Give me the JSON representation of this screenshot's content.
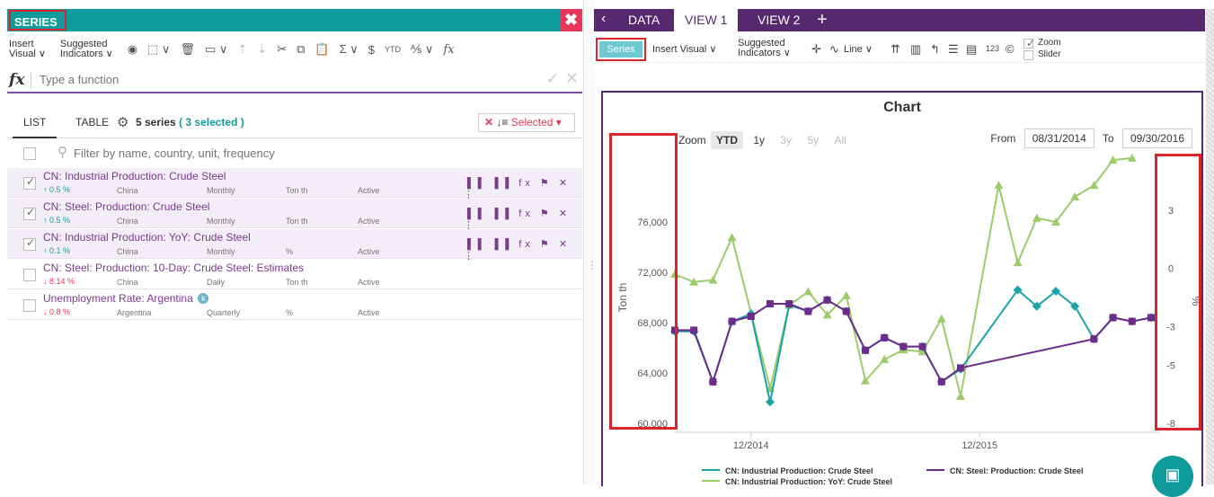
{
  "left": {
    "title": "SERIES",
    "close_icon": "close-x-icon",
    "toolbar": {
      "insert_visual_l1": "Insert",
      "insert_visual_l2": "Visual ∨",
      "suggested_l1": "Suggested",
      "suggested_l2": "Indicators ∨",
      "icons": [
        "eye-icon",
        "select-icon",
        "trash-icon",
        "folder-icon",
        "up-arrow-icon",
        "down-arrow-icon",
        "cut-icon",
        "copy-icon",
        "paste-icon",
        "sigma-icon",
        "dollar-icon",
        "ytd-icon",
        "color-icon",
        "fx-icon"
      ]
    },
    "function_bar": {
      "fx_label": "fx",
      "placeholder": "Type a function",
      "ok_glyph": "✓",
      "cancel_glyph": "✕"
    },
    "tabs": {
      "list": "LIST",
      "table": "TABLE",
      "count_text": "5 series",
      "selected_text": "( 3 selected )",
      "selected_dropdown": "Selected ▾",
      "clear_glyph": "✕",
      "sort_glyph": "↓≡"
    },
    "filter_placeholder": "Filter by name, country, unit, frequency",
    "rows": [
      {
        "name": "CN: Industrial Production: Crude Steel",
        "change": "↑ 0.5 %",
        "dir": "up",
        "country": "China",
        "freq": "Monthly",
        "unit": "Ton th",
        "status": "Active",
        "selected": true,
        "checked": true
      },
      {
        "name": "CN: Steel: Production: Crude Steel",
        "change": "↑ 0.5 %",
        "dir": "up",
        "country": "China",
        "freq": "Monthly",
        "unit": "Ton th",
        "status": "Active",
        "selected": true,
        "checked": true
      },
      {
        "name": "CN: Industrial Production: YoY: Crude Steel",
        "change": "↑ 0.1 %",
        "dir": "up",
        "country": "China",
        "freq": "Monthly",
        "unit": "%",
        "status": "Active",
        "selected": true,
        "checked": true
      },
      {
        "name": "CN: Steel: Production: 10-Day: Crude Steel: Estimates",
        "change": "↓ 8.14 %",
        "dir": "down",
        "country": "China",
        "freq": "Daily",
        "unit": "Ton th",
        "status": "Active",
        "selected": false,
        "checked": false
      },
      {
        "name": "Unemployment Rate: Argentina",
        "change": "↓ 0.8 %",
        "dir": "down",
        "country": "Argentina",
        "freq": "Quarterly",
        "unit": "%",
        "status": "Active",
        "selected": false,
        "checked": false,
        "badge": "k"
      }
    ],
    "row_actions": "▐▐ ▐▐ fx ⚑ ✕ ⋮"
  },
  "right": {
    "tabs": [
      "DATA",
      "VIEW 1",
      "VIEW 2",
      "+"
    ],
    "active_tab": "VIEW 1",
    "toolbar": {
      "series": "Series",
      "insert_visual": "Insert Visual ∨",
      "suggested_l1": "Suggested",
      "suggested_l2": "Indicators ∨",
      "line": "Line ∨",
      "zoom_l1": "Zoom",
      "zoom_l2": "Slider"
    },
    "zoom_label": "Zoom",
    "zoom_buttons": [
      "YTD",
      "1y",
      "3y",
      "5y",
      "All"
    ],
    "from_label": "From",
    "from_date": "08/31/2014",
    "to_label": "To",
    "to_date": "09/30/2016"
  },
  "colors": {
    "teal": "#0f9b9b",
    "purple": "#56286f",
    "series1": "#1aa3a8",
    "series2": "#6e2c8a",
    "series3": "#9ccc6a",
    "highlight": "#d9262c"
  },
  "chart_data": {
    "type": "line",
    "title": "Chart",
    "xlabel": "",
    "ylabel_left": "Ton th",
    "ylabel_right": "%",
    "x_tick_labels": [
      "12/2014",
      "12/2015"
    ],
    "y_left_ticks": [
      "60,000",
      "64,000",
      "68,000",
      "72,000",
      "76,000"
    ],
    "y_right_ticks": [
      "-8",
      "-5",
      "-3",
      "0",
      "3"
    ],
    "ylim_left": [
      60000,
      80000
    ],
    "ylim_right": [
      -8,
      5
    ],
    "x_months": [
      "2014-08",
      "2014-09",
      "2014-10",
      "2014-11",
      "2014-12",
      "2015-01",
      "2015-02",
      "2015-03",
      "2015-04",
      "2015-05",
      "2015-06",
      "2015-07",
      "2015-08",
      "2015-09",
      "2015-10",
      "2015-11",
      "2015-12",
      "2016-01",
      "2016-02",
      "2016-03",
      "2016-04",
      "2016-05",
      "2016-06",
      "2016-07",
      "2016-08",
      "2016-09"
    ],
    "series": [
      {
        "name": "CN: Industrial Production: Crude Steel",
        "axis": "left",
        "marker": "diamond",
        "color": "#1aa3a8",
        "values": [
          67300,
          67300,
          63300,
          68100,
          68700,
          61700,
          69400,
          68900,
          69800,
          68900,
          65800,
          66800,
          66100,
          66100,
          63300,
          64300,
          null,
          null,
          70600,
          69300,
          70500,
          69300,
          66700,
          68400,
          68100,
          68400
        ]
      },
      {
        "name": "CN: Steel: Production: Crude Steel",
        "axis": "left",
        "marker": "square",
        "color": "#6e2c8a",
        "values": [
          67400,
          67400,
          63300,
          68100,
          68500,
          69500,
          69500,
          68900,
          69800,
          68900,
          65800,
          66800,
          66100,
          66100,
          63300,
          64400,
          null,
          null,
          null,
          null,
          null,
          null,
          66700,
          68400,
          68100,
          68400
        ]
      },
      {
        "name": "CN: Industrial Production: YoY: Crude Steel",
        "axis": "right",
        "marker": "triangle",
        "color": "#9ccc6a",
        "values": [
          -0.3,
          -0.7,
          -0.6,
          1.6,
          null,
          -6.2,
          -1.9,
          -1.2,
          -2.4,
          -1.4,
          -5.8,
          -4.7,
          -4.2,
          -4.3,
          -2.6,
          -6.6,
          null,
          4.3,
          0.3,
          2.6,
          2.4,
          3.7,
          4.3,
          5.6,
          5.7,
          null
        ]
      }
    ],
    "legend": [
      "CN: Industrial Production: Crude Steel",
      "CN: Steel: Production: Crude Steel",
      "CN: Industrial Production: YoY: Crude Steel"
    ],
    "legend_position": "bottom",
    "grid": false
  }
}
